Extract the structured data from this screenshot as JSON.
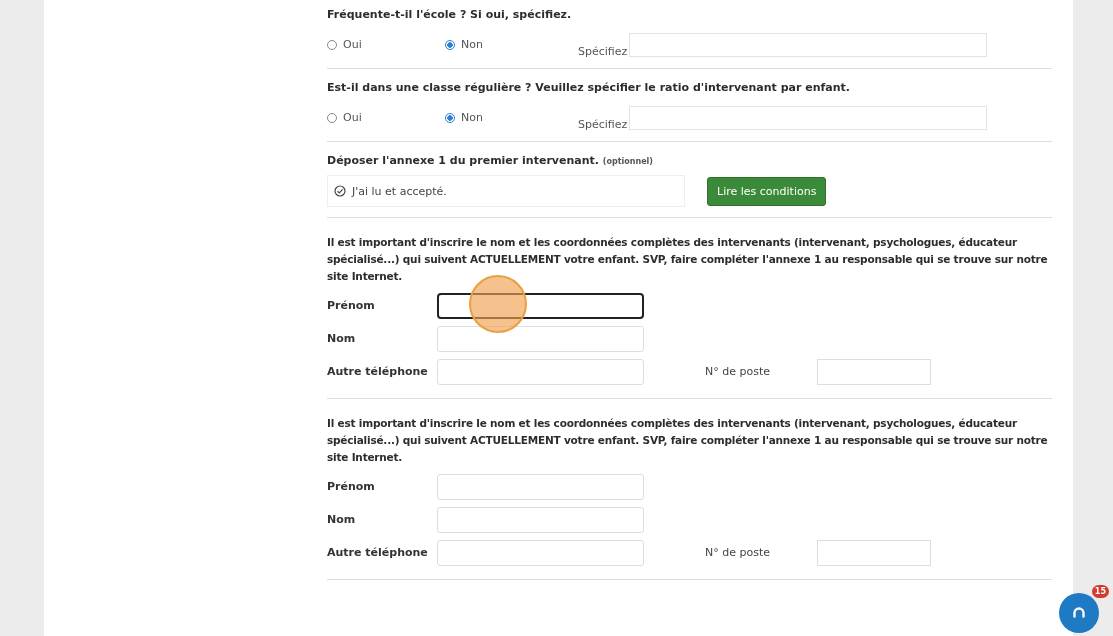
{
  "questions": [
    {
      "title": "Fréquente-t-il l'école ? Si oui, spécifiez.",
      "options": [
        {
          "label": "Oui",
          "selected": false
        },
        {
          "label": "Non",
          "selected": true
        }
      ],
      "specify_label": "Spécifiez"
    },
    {
      "title": "Est-il dans une classe régulière ? Veuillez spécifier le ratio d'intervenant par enfant.",
      "options": [
        {
          "label": "Oui",
          "selected": false
        },
        {
          "label": "Non",
          "selected": true
        }
      ],
      "specify_label": "Spécifiez"
    }
  ],
  "upload": {
    "title": "Déposer l'annexe 1 du premier intervenant.",
    "optional": "(optionnel)",
    "accept_label": "J'ai lu et accepté.",
    "checked": true,
    "button": "Lire les conditions"
  },
  "contacts": [
    {
      "notice": "Il est important d'inscrire le nom et les coordonnées complètes des intervenants (intervenant, psychologues, éducateur spécialisé...) qui suivent ACTUELLEMENT votre enfant. SVP, faire compléter l'annexe 1 au responsable qui se trouve sur notre site Internet.",
      "first_name_label": "Prénom",
      "first_name_focused": true,
      "last_name_label": "Nom",
      "phone_label": "Autre téléphone",
      "extension_label": "N° de poste"
    },
    {
      "notice": "Il est important d'inscrire le nom et les coordonnées complètes des intervenants (intervenant, psychologues, éducateur spécialisé...) qui suivent ACTUELLEMENT votre enfant. SVP, faire compléter l'annexe 1 au responsable qui se trouve sur notre site Internet.",
      "first_name_label": "Prénom",
      "first_name_focused": false,
      "last_name_label": "Nom",
      "phone_label": "Autre téléphone",
      "extension_label": "N° de poste"
    }
  ],
  "chat": {
    "badge": "15"
  }
}
